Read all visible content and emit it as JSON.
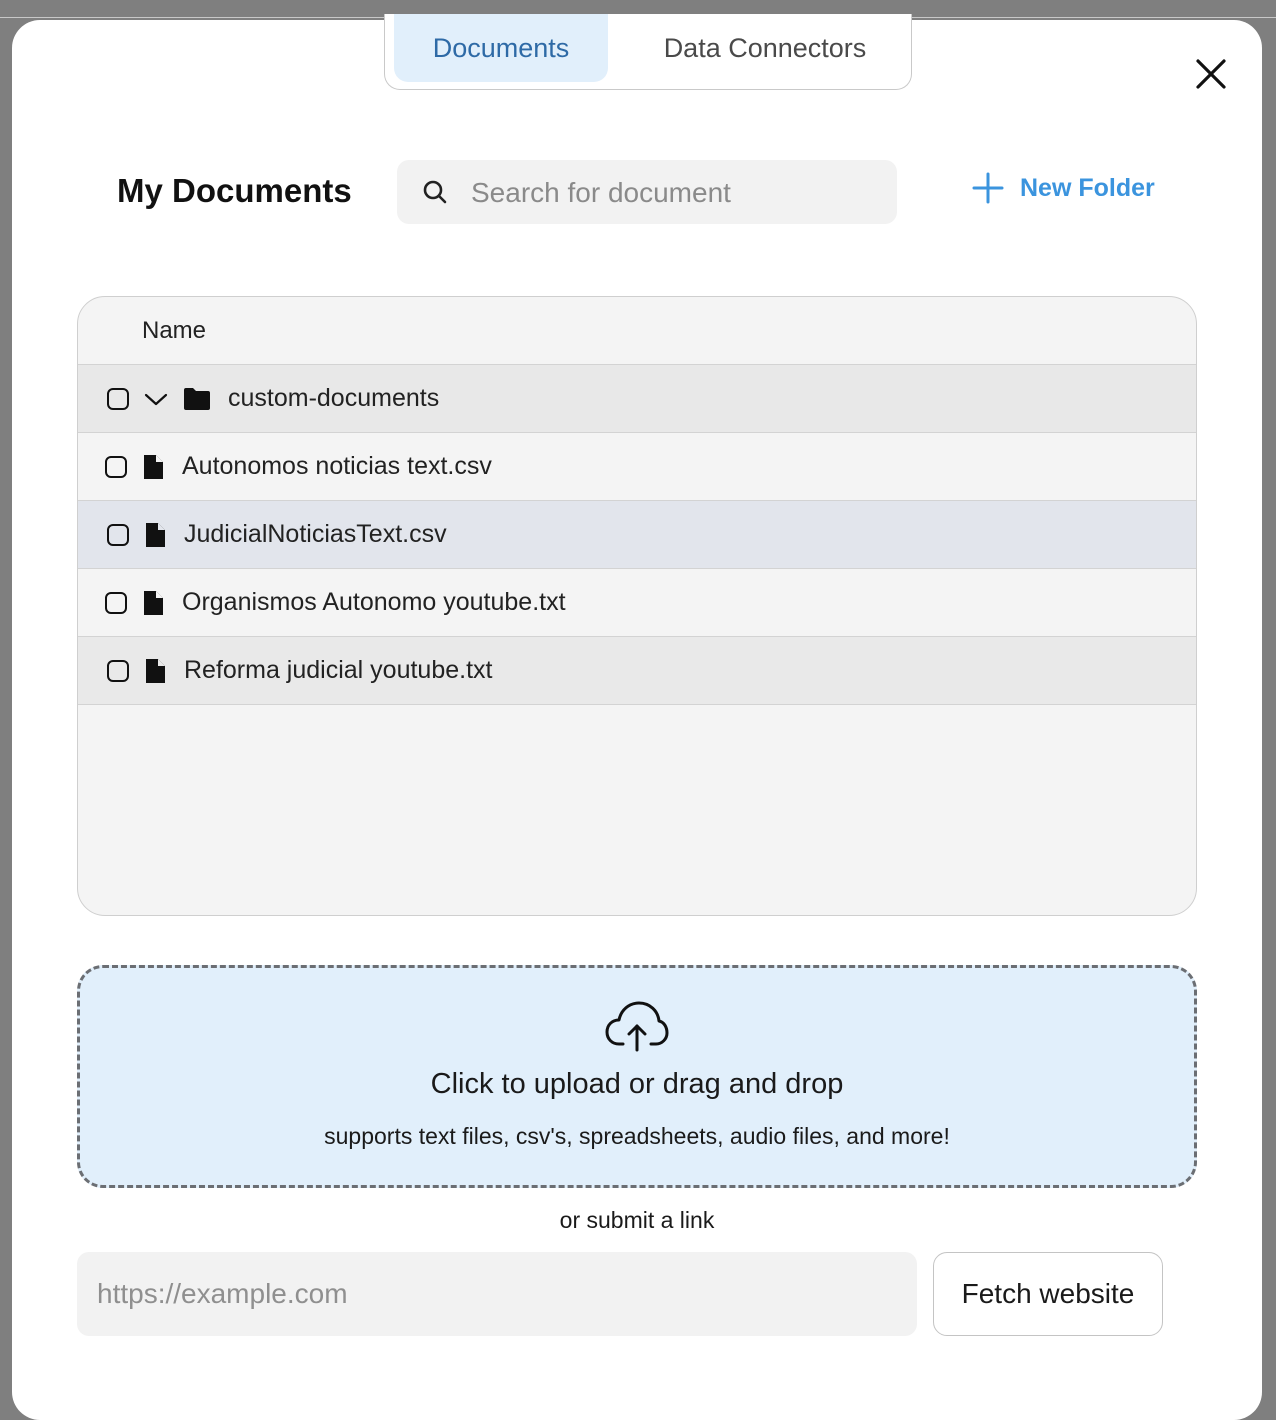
{
  "tabs": [
    {
      "label": "Documents",
      "active": true
    },
    {
      "label": "Data Connectors",
      "active": false
    }
  ],
  "header": {
    "title": "My Documents",
    "search_placeholder": "Search for document",
    "new_folder_label": "New Folder"
  },
  "table": {
    "column_name": "Name",
    "folder": {
      "name": "custom-documents",
      "expanded": true,
      "icon": "folder-icon"
    },
    "files": [
      {
        "name": "Autonomos noticias text.csv",
        "icon": "file-icon"
      },
      {
        "name": "JudicialNoticiasText.csv",
        "icon": "file-icon"
      },
      {
        "name": "Organismos Autonomo youtube.txt",
        "icon": "file-icon"
      },
      {
        "name": "Reforma judicial youtube.txt",
        "icon": "file-icon"
      }
    ]
  },
  "upload": {
    "title": "Click to upload or drag and drop",
    "subtitle": "supports text files, csv's, spreadsheets, audio files, and more!",
    "icon": "cloud-upload-icon"
  },
  "link": {
    "label": "or submit a link",
    "placeholder": "https://example.com",
    "button_label": "Fetch website"
  },
  "colors": {
    "accent": "#3b94de",
    "active_tab_bg": "#e1effb",
    "active_tab_text": "#2e6aa6",
    "upload_bg": "#e1effb"
  }
}
